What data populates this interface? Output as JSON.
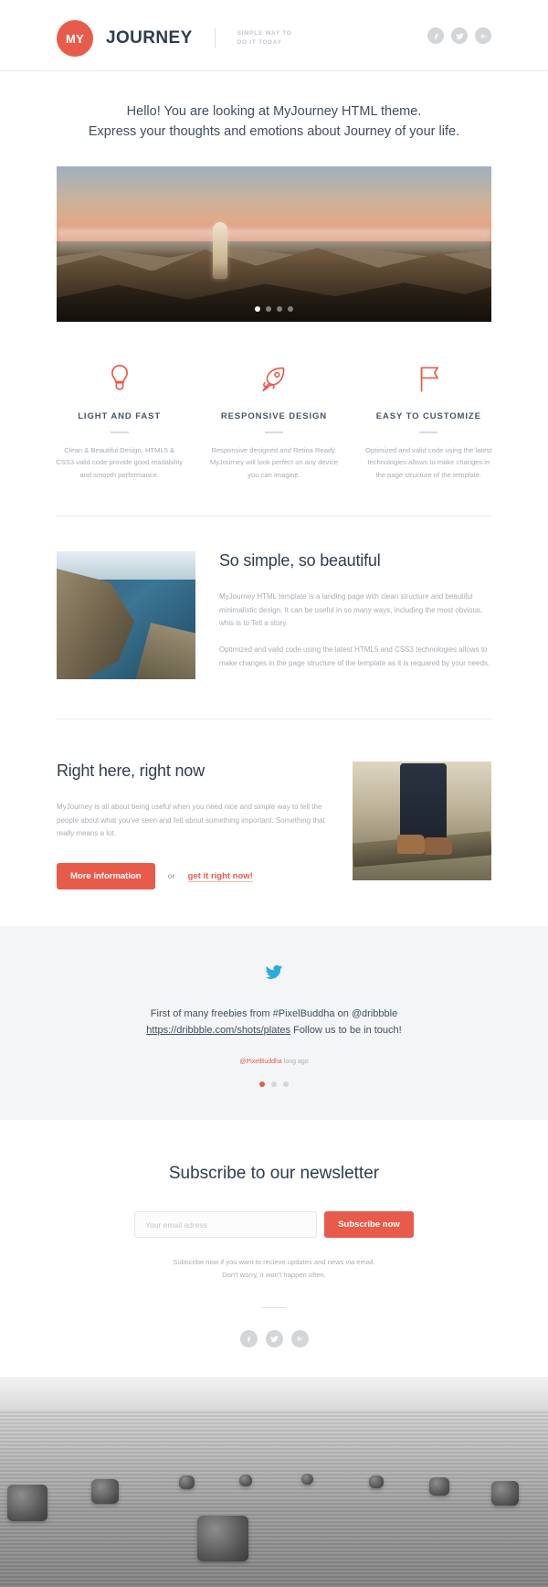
{
  "header": {
    "logo_badge": "MY",
    "brand_name": "JOURNEY",
    "tagline_line1": "SIMPLE WAY TO",
    "tagline_line2": "DO IT TODAY",
    "socials": [
      {
        "name": "facebook-icon",
        "label": "f"
      },
      {
        "name": "twitter-icon",
        "label": "t"
      },
      {
        "name": "google-plus-icon",
        "label": "g+"
      }
    ]
  },
  "intro": {
    "line1": "Hello! You are looking at MyJourney HTML theme.",
    "line2": "Express your thoughts and emotions about Journey of your life."
  },
  "hero": {
    "alt": "person standing on a mountain ridge at sunset",
    "slides_total": 4,
    "active_slide": 1
  },
  "features": [
    {
      "icon": "lightbulb-icon",
      "title": "LIGHT AND FAST",
      "body": "Clean & Beautiful Design, HTML5 & CSS3 valid code provide good readability and smooth performance."
    },
    {
      "icon": "rocket-icon",
      "title": "RESPONSIVE DESIGN",
      "body": "Responsive designed and Retina Ready. MyJourney will look perfect on any device you can imagine."
    },
    {
      "icon": "flag-icon",
      "title": "EASY TO CUSTOMIZE",
      "body": "Optimized and valid code using the latest technologies allows to make changes in the page structure of the template."
    }
  ],
  "simple_section": {
    "image_alt": "coastal cliff and blue sea",
    "heading": "So simple, so beautiful",
    "paragraph1": "MyJourney HTML template is a landing page with clean structure and beautiful minimalistic design. It can be useful in so many ways, including the most obvious, whis is to Tell a story.",
    "paragraph2": "Optimized and valid code using the latest HTML5 and CSS3 technologies allows to make changes in the page structure of the template as it is requared by your needs."
  },
  "right_now_section": {
    "heading": "Right here, right now",
    "paragraph": "MyJourney is all about being useful when you need nice and simple way to tell the people about what you've seen and felt about something important. Something that really means a lot.",
    "primary_button": "More information",
    "or_text": "or",
    "secondary_link": "get it right now!",
    "image_alt": "legs in jeans and hiking boots on a log"
  },
  "tweet_section": {
    "icon": "twitter-bird-icon",
    "text_before": "First of many freebies from #PixelBuddha on @dribbble",
    "link": "https://dribbble.com/shots/plates",
    "text_after": "Follow us to be in touch!",
    "handle": "@PixelBuddha",
    "timestamp": "long ago",
    "slides_total": 3,
    "active_slide": 1
  },
  "newsletter": {
    "heading": "Subscribe to our newsletter",
    "input_value": "",
    "input_placeholder": "Your email adress",
    "submit_label": "Subscribe now",
    "note_line1": "Subscribe now if you want to recieve updates and news via email.",
    "note_line2": "Don't worry, it won't happen often.",
    "socials": [
      {
        "name": "facebook-icon",
        "label": "f"
      },
      {
        "name": "twitter-icon",
        "label": "t"
      },
      {
        "name": "google-plus-icon",
        "label": "g+"
      }
    ]
  },
  "footer_photo": {
    "alt": "black and white field with round hay bales"
  },
  "colors": {
    "accent": "#e85b4b",
    "heading": "#2e3d4f",
    "body_text": "#a8aeb6",
    "band_bg": "#f4f5f6",
    "twitter_blue": "#2ca9e1",
    "icon_gray": "#d3d6d9"
  }
}
